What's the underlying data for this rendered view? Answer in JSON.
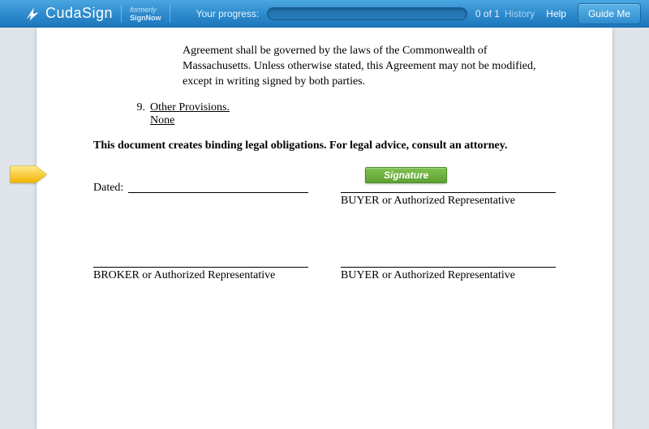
{
  "brand": {
    "name_part1": "Cuda",
    "name_part2": "Sign",
    "formerly_label": "formerly",
    "formerly_name": "SignNow"
  },
  "header": {
    "progress_label": "Your progress:",
    "progress_count": "0 of 1",
    "history_label": "History",
    "help_label": "Help",
    "guide_label": "Guide Me"
  },
  "document": {
    "governing_clause": "Agreement shall be governed by the laws of the Commonwealth of Massachusetts.  Unless otherwise stated, this Agreement may not be modified, except in writing signed by both parties.",
    "item9_number": "9.",
    "item9_heading": "Other Provisions",
    "item9_body": "None",
    "notice": "This document creates binding legal obligations.  For legal advice, consult an attorney.",
    "dated_label": "Dated:",
    "signature_button": "Signature",
    "role_buyer": "BUYER or Authorized Representative",
    "role_broker": "BROKER or Authorized Representative"
  }
}
